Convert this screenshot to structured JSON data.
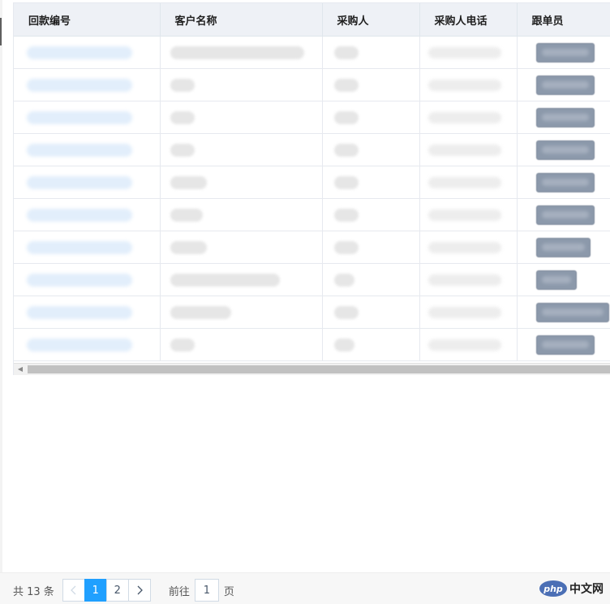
{
  "table": {
    "columns": [
      "回款编号",
      "客户名称",
      "采购人",
      "采购人电话",
      "跟单员"
    ],
    "rows": [
      {
        "code": 130,
        "customer": 165,
        "buyer": 30,
        "phone": 90,
        "staff": 70
      },
      {
        "code": 130,
        "customer": 30,
        "buyer": 30,
        "phone": 90,
        "staff": 70
      },
      {
        "code": 130,
        "customer": 30,
        "buyer": 30,
        "phone": 90,
        "staff": 70
      },
      {
        "code": 130,
        "customer": 30,
        "buyer": 30,
        "phone": 90,
        "staff": 70
      },
      {
        "code": 130,
        "customer": 45,
        "buyer": 30,
        "phone": 90,
        "staff": 70
      },
      {
        "code": 130,
        "customer": 40,
        "buyer": 30,
        "phone": 90,
        "staff": 70
      },
      {
        "code": 130,
        "customer": 45,
        "buyer": 30,
        "phone": 90,
        "staff": 65
      },
      {
        "code": 130,
        "customer": 135,
        "buyer": 25,
        "phone": 90,
        "staff": 48
      },
      {
        "code": 130,
        "customer": 75,
        "buyer": 30,
        "phone": 90,
        "staff": 88
      },
      {
        "code": 130,
        "customer": 30,
        "buyer": 25,
        "phone": 90,
        "staff": 70
      }
    ]
  },
  "pagination": {
    "total_text": "共 13 条",
    "prev_icon": "chevron-left-icon",
    "next_icon": "chevron-right-icon",
    "pages": [
      "1",
      "2"
    ],
    "current_page": "1",
    "goto_label": "前往",
    "goto_value": "1",
    "page_unit": "页"
  },
  "watermark": {
    "logo_text": "php",
    "site_text": "中文网"
  },
  "colors": {
    "header_bg": "#eef1f6",
    "active_page": "#20a0ff",
    "tag_bg": "#8c99ab",
    "watermark_blue": "#4b6fb5"
  }
}
